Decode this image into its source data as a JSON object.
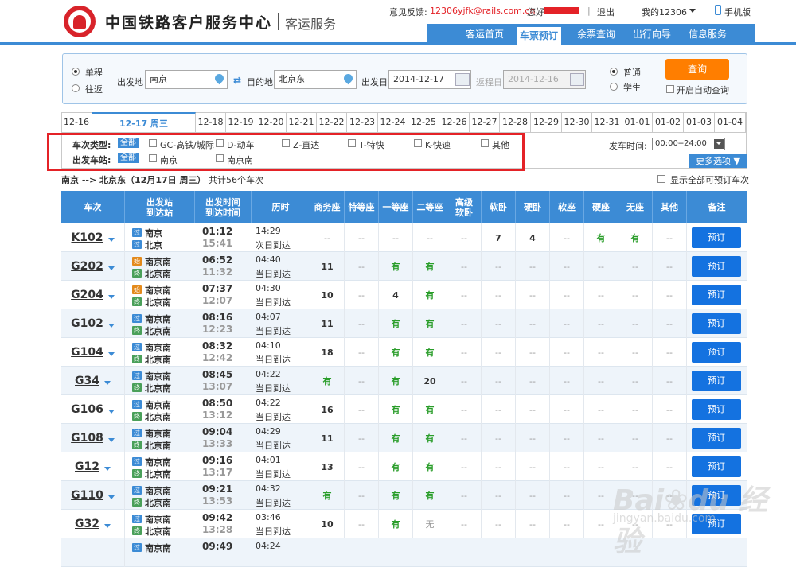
{
  "header": {
    "brand": "中国铁路客户服务中心",
    "sub": "客运服务",
    "feedback_label": "意见反馈:",
    "feedback_email": "12306yjfk@rails.com.cn",
    "greeting": "您好",
    "logout": "退出",
    "my12306": "我的12306",
    "mobile": "手机版"
  },
  "nav": [
    "客运首页",
    "车票预订",
    "余票查询",
    "出行向导",
    "信息服务"
  ],
  "query": {
    "oneway": "单程",
    "roundtrip": "往返",
    "from_label": "出发地",
    "from_value": "南京",
    "to_label": "目的地",
    "to_value": "北京东",
    "date_label": "出发日",
    "date_value": "2014-12-17",
    "return_label": "返程日",
    "return_value": "2014-12-16",
    "normal": "普通",
    "student": "学生",
    "search_button": "查询",
    "auto_query": "开启自动查询"
  },
  "dates": [
    "12-16",
    "12-17 周三",
    "12-18",
    "12-19",
    "12-20",
    "12-21",
    "12-22",
    "12-23",
    "12-24",
    "12-25",
    "12-26",
    "12-27",
    "12-28",
    "12-29",
    "12-30",
    "12-31",
    "01-01",
    "01-02",
    "01-03",
    "01-04"
  ],
  "filter": {
    "type_label": "车次类型:",
    "station_label": "出发车站:",
    "all": "全部",
    "types": [
      "GC-高铁/城际",
      "D-动车",
      "Z-直达",
      "T-特快",
      "K-快速",
      "其他"
    ],
    "stations": [
      "南京",
      "南京南"
    ],
    "time_label": "发车时间:",
    "time_value": "00:00--24:00",
    "more": "更多选项"
  },
  "summary": {
    "route": "南京 --> 北京东（12月17日  周三）",
    "count": "共计56个车次",
    "show_all": "显示全部可预订车次"
  },
  "columns": [
    "车次",
    "出发站\n到达站",
    "出发时间\n到达时间",
    "历时",
    "商务座",
    "特等座",
    "一等座",
    "二等座",
    "高级\n软卧",
    "软卧",
    "硬卧",
    "软座",
    "硬座",
    "无座",
    "其他",
    "备注"
  ],
  "book_label": "预订",
  "trains": [
    {
      "no": "K102",
      "from": "南京",
      "to": "北京",
      "fi": "过",
      "ti": "过",
      "dep": "01:12",
      "arr": "15:41",
      "dur": "14:29",
      "arrival": "次日到达",
      "seats": [
        "--",
        "--",
        "--",
        "--",
        "--",
        "7",
        "4",
        "--",
        "有",
        "有",
        "--"
      ]
    },
    {
      "no": "G202",
      "from": "南京南",
      "to": "北京南",
      "fi": "始",
      "ti": "终",
      "dep": "06:52",
      "arr": "11:32",
      "dur": "04:40",
      "arrival": "当日到达",
      "seats": [
        "11",
        "--",
        "有",
        "有",
        "--",
        "--",
        "--",
        "--",
        "--",
        "--",
        "--"
      ]
    },
    {
      "no": "G204",
      "from": "南京南",
      "to": "北京南",
      "fi": "始",
      "ti": "终",
      "dep": "07:37",
      "arr": "12:07",
      "dur": "04:30",
      "arrival": "当日到达",
      "seats": [
        "10",
        "--",
        "4",
        "有",
        "--",
        "--",
        "--",
        "--",
        "--",
        "--",
        "--"
      ]
    },
    {
      "no": "G102",
      "from": "南京南",
      "to": "北京南",
      "fi": "过",
      "ti": "终",
      "dep": "08:16",
      "arr": "12:23",
      "dur": "04:07",
      "arrival": "当日到达",
      "seats": [
        "11",
        "--",
        "有",
        "有",
        "--",
        "--",
        "--",
        "--",
        "--",
        "--",
        "--"
      ]
    },
    {
      "no": "G104",
      "from": "南京南",
      "to": "北京南",
      "fi": "过",
      "ti": "终",
      "dep": "08:32",
      "arr": "12:42",
      "dur": "04:10",
      "arrival": "当日到达",
      "seats": [
        "18",
        "--",
        "有",
        "有",
        "--",
        "--",
        "--",
        "--",
        "--",
        "--",
        "--"
      ]
    },
    {
      "no": "G34",
      "from": "南京南",
      "to": "北京南",
      "fi": "过",
      "ti": "终",
      "dep": "08:45",
      "arr": "13:07",
      "dur": "04:22",
      "arrival": "当日到达",
      "seats": [
        "有",
        "--",
        "有",
        "20",
        "--",
        "--",
        "--",
        "--",
        "--",
        "--",
        "--"
      ]
    },
    {
      "no": "G106",
      "from": "南京南",
      "to": "北京南",
      "fi": "过",
      "ti": "终",
      "dep": "08:50",
      "arr": "13:12",
      "dur": "04:22",
      "arrival": "当日到达",
      "seats": [
        "16",
        "--",
        "有",
        "有",
        "--",
        "--",
        "--",
        "--",
        "--",
        "--",
        "--"
      ]
    },
    {
      "no": "G108",
      "from": "南京南",
      "to": "北京南",
      "fi": "过",
      "ti": "终",
      "dep": "09:04",
      "arr": "13:33",
      "dur": "04:29",
      "arrival": "当日到达",
      "seats": [
        "11",
        "--",
        "有",
        "有",
        "--",
        "--",
        "--",
        "--",
        "--",
        "--",
        "--"
      ]
    },
    {
      "no": "G12",
      "from": "南京南",
      "to": "北京南",
      "fi": "过",
      "ti": "终",
      "dep": "09:16",
      "arr": "13:17",
      "dur": "04:01",
      "arrival": "当日到达",
      "seats": [
        "13",
        "--",
        "有",
        "有",
        "--",
        "--",
        "--",
        "--",
        "--",
        "--",
        "--"
      ]
    },
    {
      "no": "G110",
      "from": "南京南",
      "to": "北京南",
      "fi": "过",
      "ti": "终",
      "dep": "09:21",
      "arr": "13:53",
      "dur": "04:32",
      "arrival": "当日到达",
      "seats": [
        "有",
        "--",
        "有",
        "有",
        "--",
        "--",
        "--",
        "--",
        "--",
        "--",
        "--"
      ]
    },
    {
      "no": "G32",
      "from": "南京南",
      "to": "北京南",
      "fi": "过",
      "ti": "终",
      "dep": "09:42",
      "arr": "13:28",
      "dur": "03:46",
      "arrival": "当日到达",
      "seats": [
        "10",
        "--",
        "有",
        "无",
        "--",
        "--",
        "--",
        "--",
        "--",
        "--",
        "--"
      ]
    },
    {
      "no": "",
      "from": "南京南",
      "to": "",
      "fi": "过",
      "ti": "",
      "dep": "09:49",
      "arr": "",
      "dur": "04:24",
      "arrival": "",
      "seats": []
    }
  ],
  "watermark": {
    "text": "Bai du 经验",
    "url": "jingyan.baidu.com"
  }
}
